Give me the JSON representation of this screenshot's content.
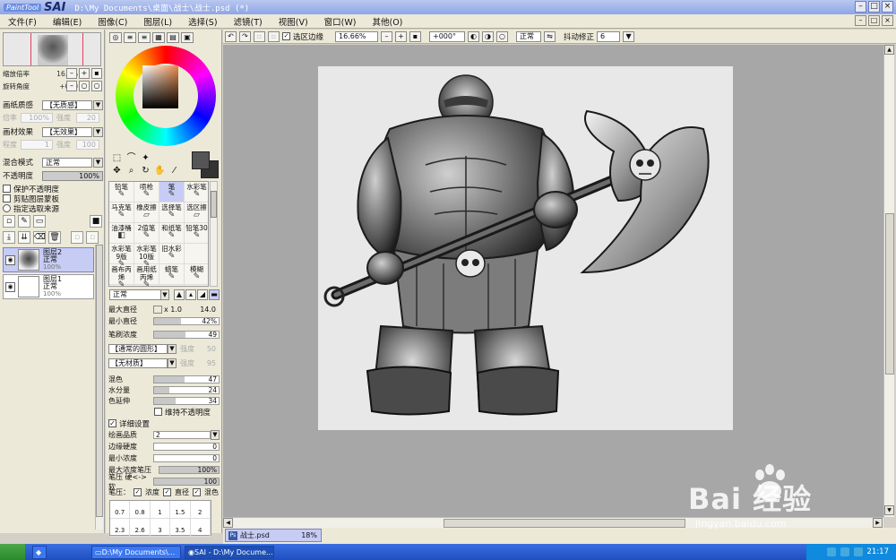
{
  "app": {
    "logo_small": "PaintTool",
    "logo_big": "SAI",
    "title": "D:\\My Documents\\桌面\\战士\\战士.psd (*)"
  },
  "menu": [
    "文件(F)",
    "编辑(E)",
    "图像(C)",
    "图层(L)",
    "选择(S)",
    "滤镜(T)",
    "视图(V)",
    "窗口(W)",
    "其他(O)"
  ],
  "navigator": {
    "zoom_label": "缩放倍率",
    "zoom_value": "16.7%",
    "rotate_label": "旋转角度",
    "rotate_value": "+000"
  },
  "paper": {
    "texture_label": "画纸质感",
    "texture_value": "【无质感】",
    "texture_scale_label": "倍率",
    "texture_scale_value": "100%",
    "texture_strength_label": "强度",
    "texture_strength_value": "20",
    "effect_label": "画材效果",
    "effect_value": "【无效果】",
    "effect_degree_label": "程度",
    "effect_degree_value": "1",
    "effect_strength_label": "强度",
    "effect_strength_value": "100"
  },
  "layer_props": {
    "blend_label": "混合模式",
    "blend_value": "正常",
    "opacity_label": "不透明度",
    "opacity_value": "100%",
    "opt1": "保护不透明度",
    "opt2": "剪贴图层蒙板",
    "opt3": "指定选取来源"
  },
  "layers": [
    {
      "name": "图层2",
      "mode": "正常",
      "opacity": "100%"
    },
    {
      "name": "图层1",
      "mode": "正常",
      "opacity": "100%"
    }
  ],
  "brushes": [
    "铅笔",
    "喷枪",
    "笔",
    "水彩笔",
    "马克笔",
    "橡皮擦",
    "选择笔",
    "选区擦",
    "油漆桶",
    "2值笔",
    "和纸笔",
    "铅笔30",
    "水彩笔9版",
    "水彩笔10版",
    "旧水彩",
    "",
    "画布丙烯",
    "画用纸丙烯",
    "蜡笔",
    "模糊"
  ],
  "brush_settings": {
    "mode": "正常",
    "max_size_label": "最大直径",
    "max_size_mult": "x 1.0",
    "max_size_value": "14.0",
    "min_size_label": "最小直径",
    "min_size_value": "42%",
    "min_size_pct": 42,
    "density_label": "笔刷浓度",
    "density_value": "49",
    "shape_value": "【通常的圆形】",
    "shape_strength_label": "强度",
    "shape_strength_value": "50",
    "texture_value": "【无材质】",
    "texture_strength_label": "强度",
    "texture_strength_value": "95",
    "blend_label": "混色",
    "blend_value": "47",
    "water_label": "水分量",
    "water_value": "24",
    "persist_label": "色延伸",
    "persist_value": "34",
    "keep_opacity_label": "维持不透明度",
    "detail_label": "详细设置",
    "quality_label": "绘画品质",
    "quality_value": "2",
    "edge_label": "边缘硬度",
    "edge_value": "0",
    "min_density_label": "最小浓度",
    "min_density_value": "0",
    "max_dens_press_label": "最大浓度笔压",
    "max_dens_press_value": "100%",
    "press_hard_label": "笔压 硬<->软",
    "press_hard_value": "100",
    "press_label": "笔压：",
    "press_density": "浓度",
    "press_size": "直径",
    "press_blend": "混色"
  },
  "brush_sizes": [
    "0.7",
    "0.8",
    "1",
    "1.5",
    "2",
    "2.3",
    "2.6",
    "3",
    "3.5",
    "4"
  ],
  "canvas_toolbar": {
    "show_selection_label": "选区边缘",
    "zoom": "16.66%",
    "angle": "+000°",
    "mode": "正常",
    "stabilizer_label": "抖动修正",
    "stabilizer_value": "6"
  },
  "doc_tab": {
    "name": "战士.psd",
    "zoom": "18%",
    "ps_badge": "Ps"
  },
  "taskbar": {
    "items": [
      "D:\\My Documents\\...",
      "SAI - D:\\My Docume..."
    ],
    "clock": "21:17"
  },
  "watermark": {
    "text": "Bai  经验",
    "url": "jingyan.baidu.com"
  }
}
